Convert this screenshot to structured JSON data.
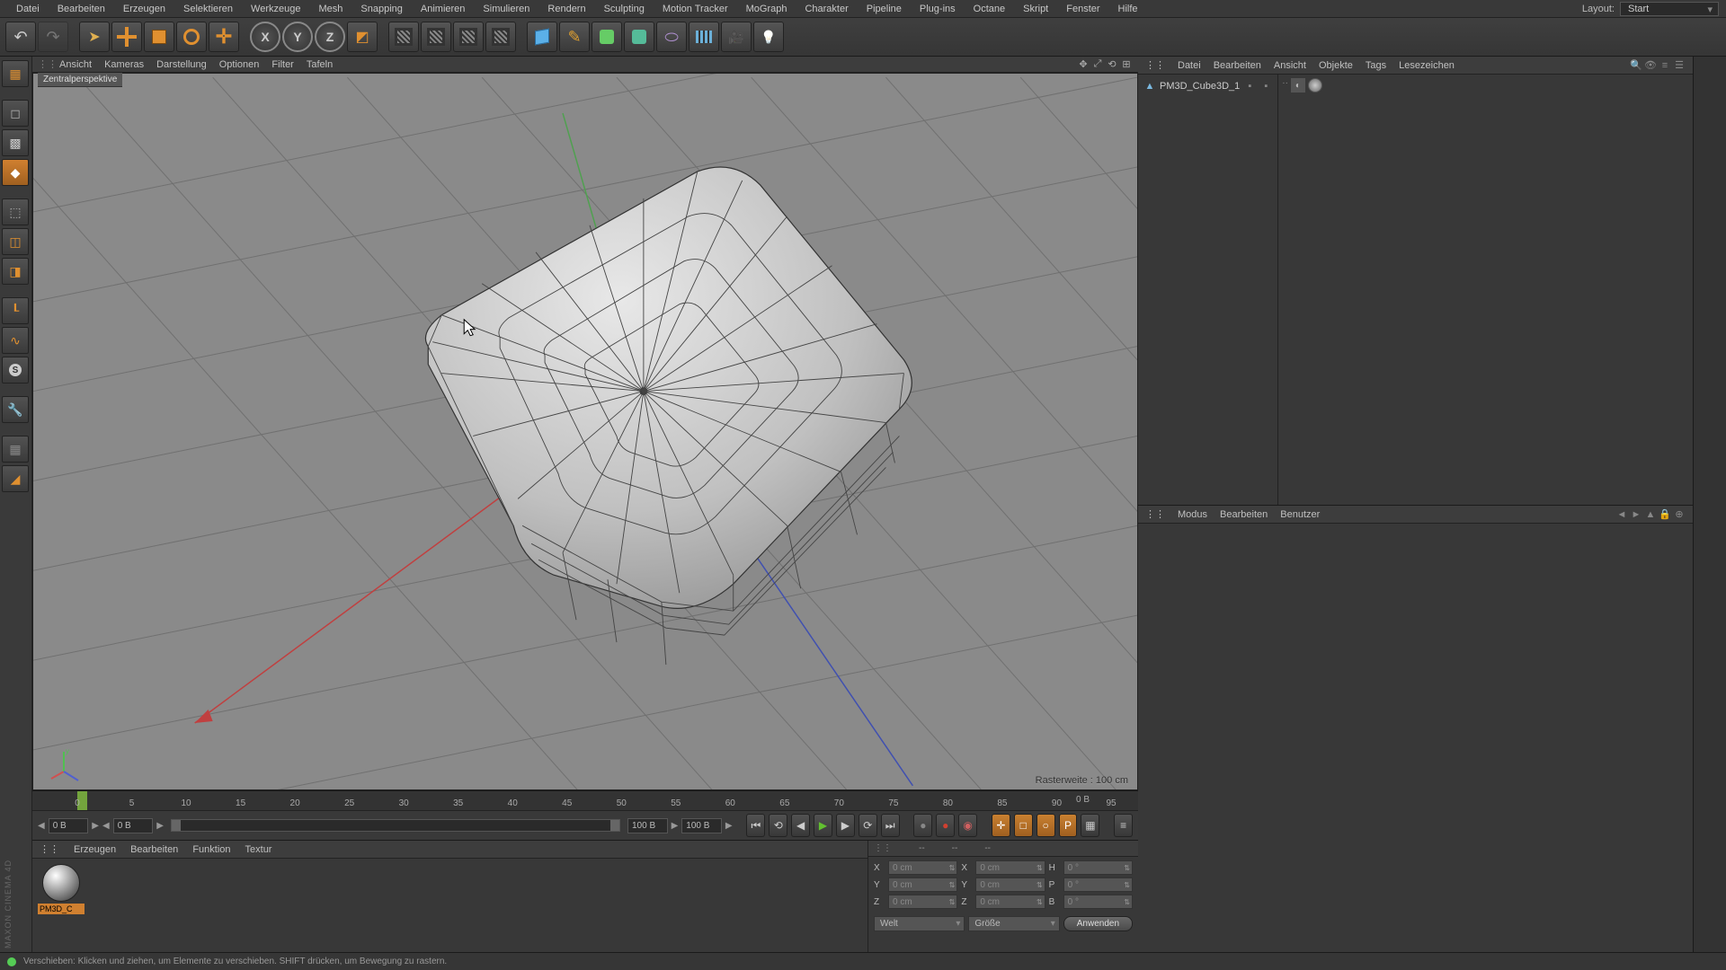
{
  "menu": [
    "Datei",
    "Bearbeiten",
    "Erzeugen",
    "Selektieren",
    "Werkzeuge",
    "Mesh",
    "Snapping",
    "Animieren",
    "Simulieren",
    "Rendern",
    "Sculpting",
    "Motion Tracker",
    "MoGraph",
    "Charakter",
    "Pipeline",
    "Plug-ins",
    "Octane",
    "Skript",
    "Fenster",
    "Hilfe"
  ],
  "layout": {
    "label": "Layout:",
    "value": "Start"
  },
  "axes": [
    "X",
    "Y",
    "Z"
  ],
  "viewport_menu": [
    "Ansicht",
    "Kameras",
    "Darstellung",
    "Optionen",
    "Filter",
    "Tafeln"
  ],
  "viewport_label": "Zentralperspektive",
  "grid_text": "Rasterweite : 100 cm",
  "timeline": {
    "ticks": [
      0,
      5,
      10,
      15,
      20,
      25,
      30,
      35,
      40,
      45,
      50,
      55,
      60,
      65,
      70,
      75,
      80,
      85,
      90,
      95
    ],
    "start_field": "0 B",
    "end_field": "0 B",
    "range_left": "100 B",
    "range_right": "100 B",
    "end_label": "0 B"
  },
  "material_menu": [
    "Erzeugen",
    "Bearbeiten",
    "Funktion",
    "Textur"
  ],
  "material": {
    "name": "PM3D_C"
  },
  "coord": {
    "heads": [
      "--",
      "--",
      "--"
    ],
    "rows": [
      {
        "axis": "X",
        "p": "0 cm",
        "s": "0 cm",
        "r": "0 °",
        "rl": "H"
      },
      {
        "axis": "Y",
        "p": "0 cm",
        "s": "0 cm",
        "r": "0 °",
        "rl": "P"
      },
      {
        "axis": "Z",
        "p": "0 cm",
        "s": "0 cm",
        "r": "0 °",
        "rl": "B"
      }
    ],
    "drop1": "Welt",
    "drop2": "Größe",
    "apply": "Anwenden"
  },
  "status": "Verschieben: Klicken und ziehen, um Elemente zu verschieben. SHIFT drücken, um Bewegung zu rastern.",
  "obj_menu": [
    "Datei",
    "Bearbeiten",
    "Ansicht",
    "Objekte",
    "Tags",
    "Lesezeichen"
  ],
  "object": {
    "name": "PM3D_Cube3D_1"
  },
  "attr_menu": [
    "Modus",
    "Bearbeiten",
    "Benutzer"
  ],
  "logo": "MAXON CINEMA 4D"
}
